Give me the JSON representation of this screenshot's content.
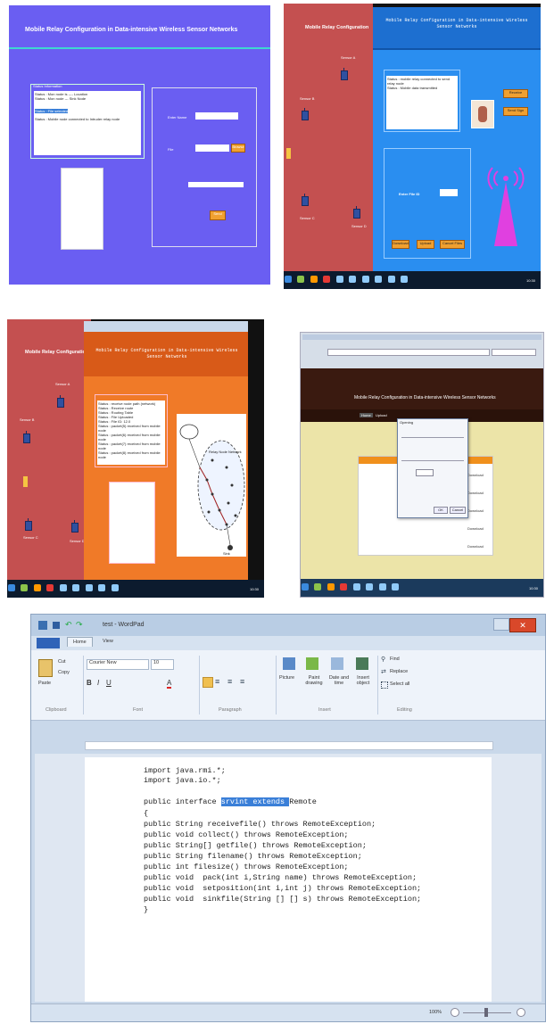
{
  "p1": {
    "title": "Mobile Relay Configuration in Data-intensive Wireless Sensor Networks",
    "status_lines": [
      "Status : Mon node is ---- Location",
      "Status : Mon node --- Sink Node",
      "Status : File selected",
      "Status : Mobile node connected to Intruder relay node"
    ],
    "enter_name_label": "Enter Name",
    "file_label": "File",
    "browse_label": "Browse",
    "send_label": "Send"
  },
  "p2": {
    "sidebar_title": "Mobile Relay Configuration",
    "header_title": "Mobile Relay Configuration in Data-intensive Wireless Sensor Networks",
    "status_lines": [
      "Status : mobile relay connected to send relay node",
      "Status : Mobile data transmitted"
    ],
    "enter_file_label": "Enter File ID",
    "buttons": [
      "Receive",
      "Send Sign"
    ],
    "bottom_buttons": [
      "Download",
      "Upload",
      "Cancel Files"
    ],
    "node_labels": [
      "Sensor A",
      "Sensor B",
      "Sensor C",
      "Sensor D"
    ],
    "clock": "10:30"
  },
  "p3": {
    "sidebar_title": "Mobile Relay Configuration",
    "header_title": "Mobile Relay Configuration in Data-intensive Wireless Sensor Networks",
    "status_lines": [
      "Status : receive node path (network)",
      "Status : Receive route",
      "Status : Routing Table",
      "Status : File Uploaded",
      "Status : File ID: 12.0",
      "Status : packet(5) received from mobile node",
      "Status : packet(6) received from mobile node",
      "Status : packet(7) received from mobile node",
      "Status : packet(8) received from mobile node"
    ],
    "cloud_label": "Relay Node Network",
    "sink_label": "Sink",
    "node_labels": [
      "Sensor A",
      "Sensor B",
      "Sensor C",
      "Sensor D"
    ],
    "clock": "10:30"
  },
  "p4": {
    "header_title": "Mobile Relay Configuration in Data-intensive Wireless Sensor Networks",
    "nav": [
      "Home",
      "Upload"
    ],
    "dialog_title": "Opening",
    "dialog_ok": "OK",
    "dialog_cancel": "Cancel",
    "download_labels": [
      "Download",
      "Download",
      "Download",
      "Download",
      "Download"
    ],
    "clock": "10:30"
  },
  "wordpad": {
    "title": "test - WordPad",
    "tabs": [
      "Home",
      "View"
    ],
    "clipboard": {
      "paste": "Paste",
      "cut": "Cut",
      "copy": "Copy",
      "label": "Clipboard"
    },
    "font": {
      "name": "Courier New",
      "size": "10",
      "label": "Font"
    },
    "paragraph_label": "Paragraph",
    "insert": {
      "picture": "Picture",
      "paint": "Paint drawing",
      "datetime": "Date and time",
      "object": "Insert object",
      "label": "Insert"
    },
    "editing": {
      "find": "Find",
      "replace": "Replace",
      "select_all": "Select all",
      "label": "Editing"
    },
    "code": [
      "import java.rmi.*;",
      "import java.io.*;",
      "",
      "public interface ",
      "{",
      "public String receivefile() throws RemoteException;",
      "public void collect() throws RemoteException;",
      "public String[] getfile() throws RemoteException;",
      "public String filename() throws RemoteException;",
      "public int filesize() throws RemoteException;",
      "public void  pack(int i,String name) throws RemoteException;",
      "public void  setposition(int i,int j) throws RemoteException;",
      "public void  sinkfile(String [] [] s) throws RemoteException;",
      "}"
    ],
    "interface_selected": "srvint extends ",
    "interface_tail": "Remote",
    "zoom": "100%"
  },
  "colors": {
    "blue_purple": "#6a5ef2",
    "red_sidebar": "#c45050",
    "blue_main": "#2a8ef0",
    "orange_main": "#f07a28",
    "selection": "#3a7fd8"
  }
}
